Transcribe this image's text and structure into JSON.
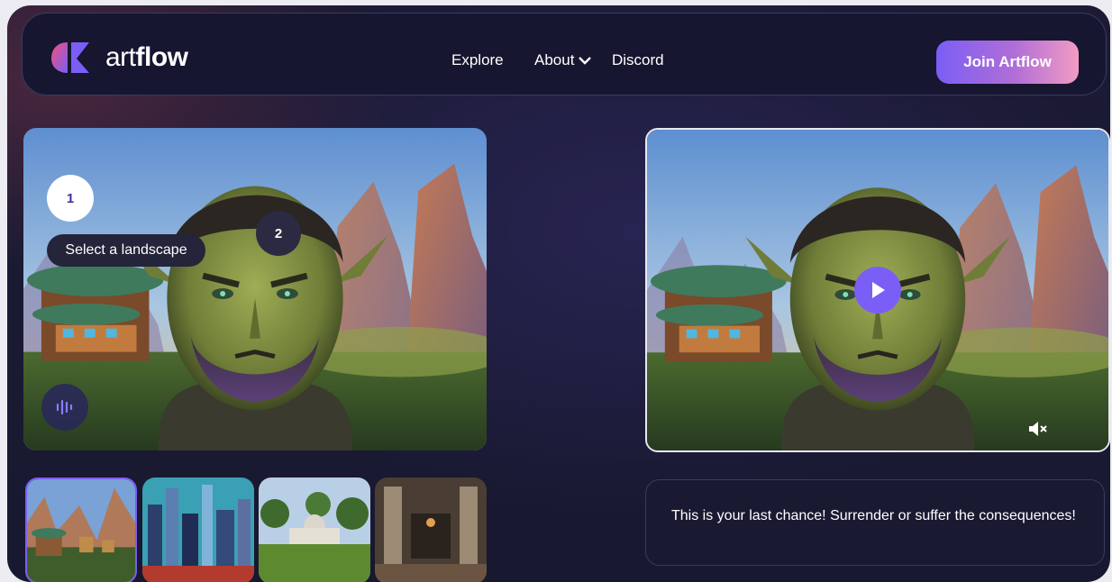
{
  "header": {
    "brand_light": "art",
    "brand_bold": "flow",
    "nav": {
      "explore": "Explore",
      "about": "About",
      "discord": "Discord"
    },
    "join_button": "Join Artflow",
    "logo_icon": "artflow-logo-icon",
    "about_icon": "chevron-down-icon"
  },
  "editor": {
    "step1": "1",
    "step2": "2",
    "tooltip": "Select a landscape",
    "voice_icon": "waveform-icon"
  },
  "preview": {
    "play_icon": "play-icon",
    "mute_icon": "volume-mute-icon"
  },
  "landscapes": [
    {
      "name": "fantasy-village",
      "selected": true
    },
    {
      "name": "futuristic-city",
      "selected": false
    },
    {
      "name": "capitol-building",
      "selected": false
    },
    {
      "name": "dark-room",
      "selected": false
    }
  ],
  "dialogue": "This is your last chance! Surrender or suffer the consequences!",
  "colors": {
    "accent": "#7b5ef5",
    "button_gradient_end": "#f39bc4",
    "background": "#1a1a33"
  }
}
